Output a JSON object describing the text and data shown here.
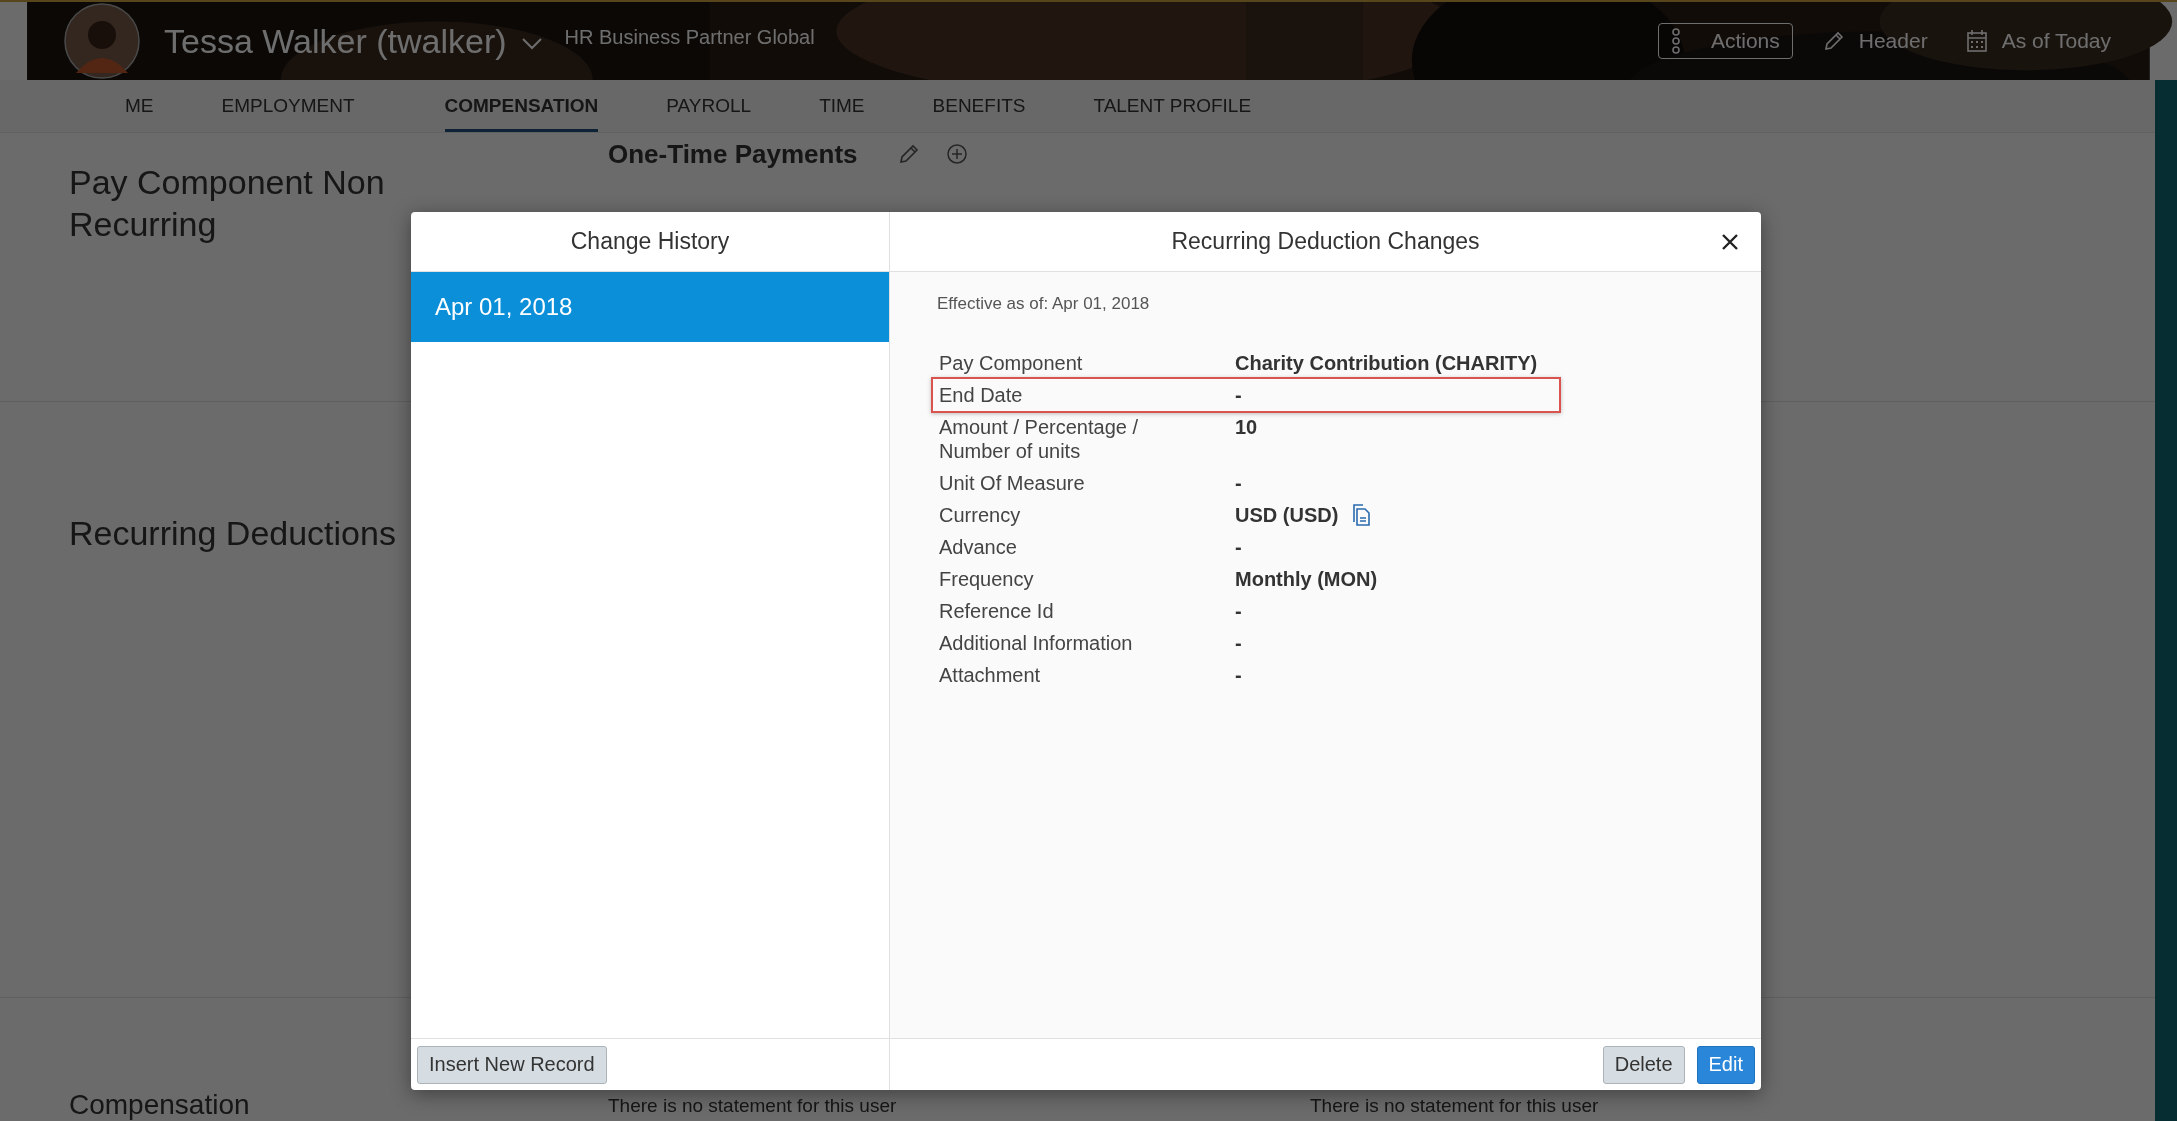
{
  "header": {
    "name": "Tessa Walker (twalker)",
    "role": "HR Business Partner Global",
    "actions": [
      {
        "kind": "menu",
        "label": "Actions"
      },
      {
        "kind": "edit",
        "label": "Header"
      },
      {
        "kind": "calendar",
        "label": "As of Today"
      }
    ]
  },
  "tabs": [
    {
      "label": "ME",
      "selected": false
    },
    {
      "label": "EMPLOYMENT",
      "selected": false
    },
    {
      "label": "COMPENSATION",
      "selected": true
    },
    {
      "label": "PAYROLL",
      "selected": false
    },
    {
      "label": "TIME",
      "selected": false
    },
    {
      "label": "BENEFITS",
      "selected": false
    },
    {
      "label": "TALENT PROFILE",
      "selected": false
    }
  ],
  "page": {
    "sections": [
      {
        "title": "Pay Component Non Recurring",
        "card_title": "One-Time Payments"
      },
      {
        "title": "Recurring Deductions"
      },
      {
        "title": "Compensation",
        "statements": [
          "There is no statement for this user",
          "There is no statement for this user"
        ]
      }
    ]
  },
  "dialog": {
    "history_title": "Change History",
    "history": [
      {
        "label": "Apr 01, 2018",
        "selected": true
      }
    ],
    "detail_title": "Recurring Deduction Changes",
    "effective": "Effective as of: Apr 01, 2018",
    "fields": [
      {
        "label": "Pay Component",
        "value": "Charity Contribution (CHARITY)",
        "highlighted": false,
        "copy": false
      },
      {
        "label": "End Date",
        "value": "-",
        "highlighted": true,
        "copy": false
      },
      {
        "label": "Amount / Percentage / Number of units",
        "value": "10",
        "highlighted": false,
        "copy": false
      },
      {
        "label": "Unit Of Measure",
        "value": "-",
        "highlighted": false,
        "copy": false
      },
      {
        "label": "Currency",
        "value": "USD (USD)",
        "highlighted": false,
        "copy": true
      },
      {
        "label": "Advance",
        "value": "-",
        "highlighted": false,
        "copy": false
      },
      {
        "label": "Frequency",
        "value": "Monthly (MON)",
        "highlighted": false,
        "copy": false
      },
      {
        "label": "Reference Id",
        "value": "-",
        "highlighted": false,
        "copy": false
      },
      {
        "label": "Additional Information",
        "value": "-",
        "highlighted": false,
        "copy": false
      },
      {
        "label": "Attachment",
        "value": "-",
        "highlighted": false,
        "copy": false
      }
    ],
    "footer_left": [
      {
        "label": "Insert New Record",
        "kind": "secondary"
      }
    ],
    "footer_right": [
      {
        "label": "Delete",
        "kind": "secondary"
      },
      {
        "label": "Edit",
        "kind": "primary"
      }
    ]
  }
}
